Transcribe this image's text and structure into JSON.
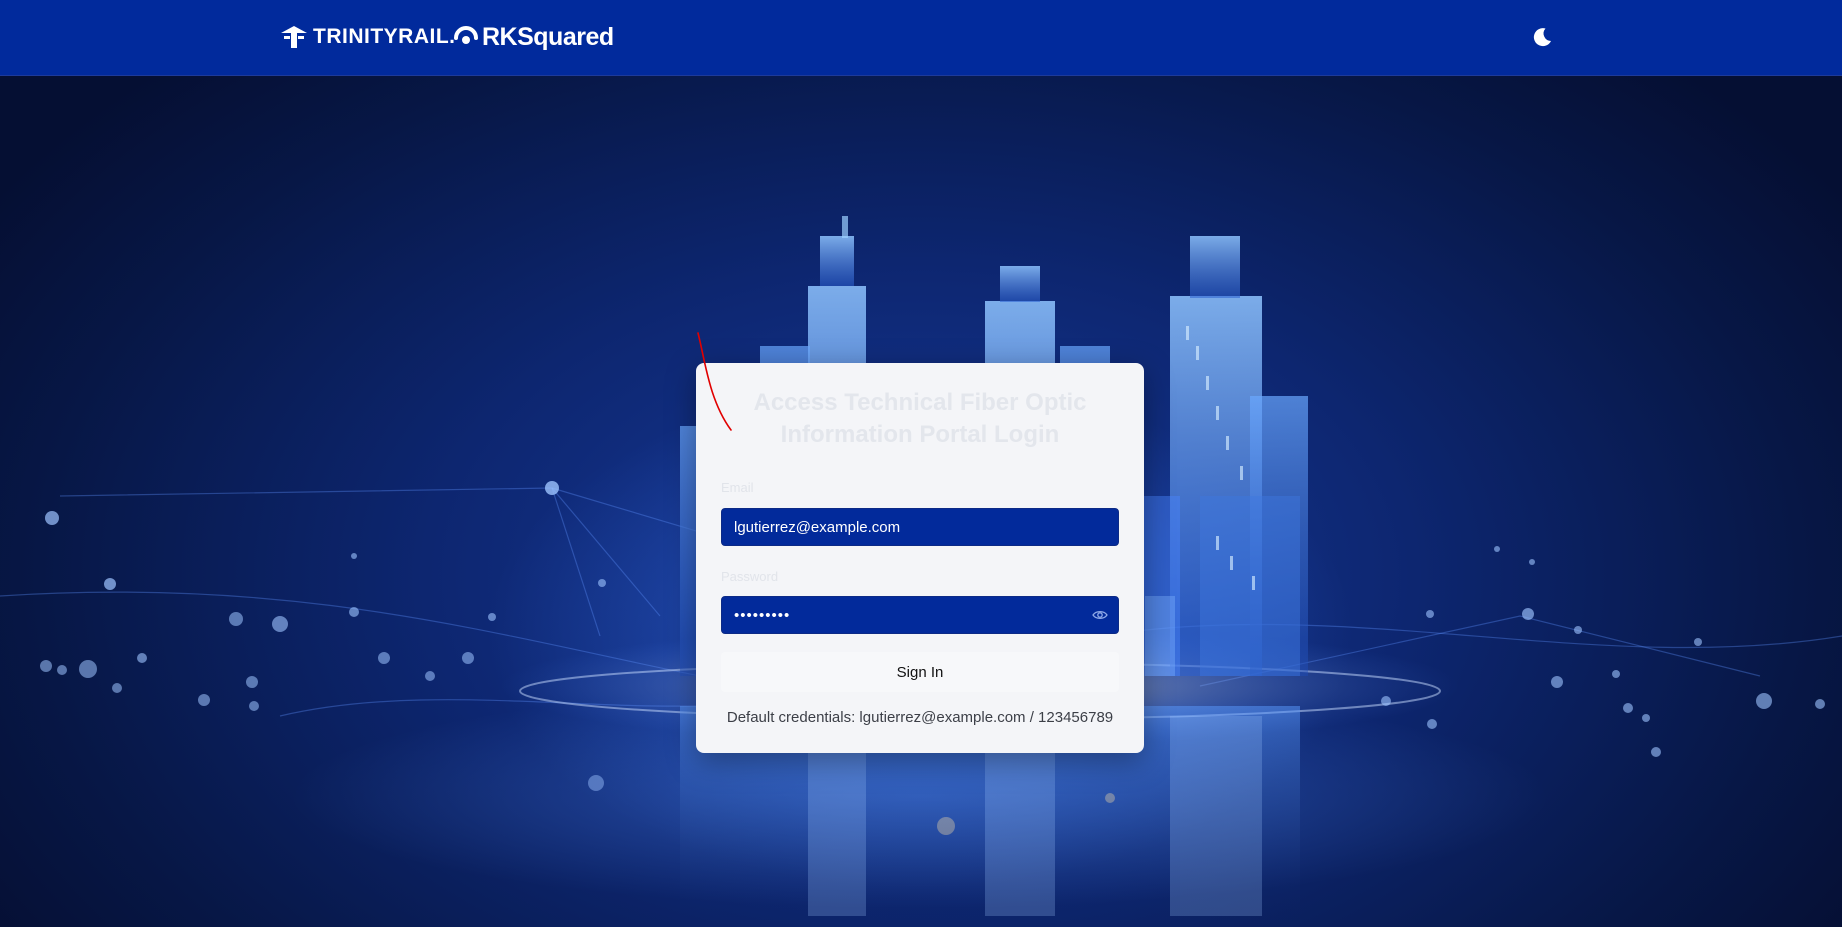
{
  "header": {
    "brand_primary": "TRINITYRAIL",
    "brand_secondary": "RKSquared",
    "theme_toggle_icon": "moon-icon",
    "background_color": "#012a9c"
  },
  "login": {
    "title": "Access Technical Fiber Optic Information Portal Login",
    "email_label": "Email",
    "email_value": "lgutierrez@example.com",
    "password_label": "Password",
    "password_value": "123456789",
    "password_toggle_icon": "eye-icon",
    "sign_in_label": "Sign In",
    "credentials_note": "Default credentials: lgutierrez@example.com / 123456789",
    "input_color": "#022a9b"
  },
  "background": {
    "description_icon": "city-skyline-illustration"
  }
}
